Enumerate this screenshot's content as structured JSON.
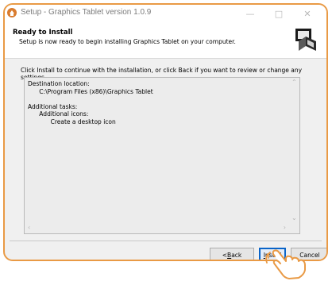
{
  "window": {
    "title": "Setup - Graphics Tablet version 1.0.9",
    "controls": {
      "minimize": "—",
      "maximize": "□",
      "close": "✕"
    }
  },
  "header": {
    "title": "Ready to Install",
    "subtitle": "Setup is now ready to begin installing Graphics Tablet on your computer."
  },
  "intro": "Click Install to continue with the installation, or click Back if you want to review or change any settings.",
  "memo": {
    "text": "Destination location:\n      C:\\Program Files (x86)\\Graphics Tablet\n\nAdditional tasks:\n      Additional icons:\n            Create a desktop icon"
  },
  "buttons": {
    "back": {
      "prefix": "< ",
      "accel": "B",
      "rest": "ack"
    },
    "install": {
      "accel": "I",
      "rest": "nstall"
    },
    "cancel": "Cancel"
  },
  "colors": {
    "frame": "#e99a45",
    "default_button": "#0a64c8",
    "hand": "#e99a45"
  },
  "icons": [
    "setup-app-icon",
    "computer-install-icon",
    "pointing-hand-cursor-icon"
  ]
}
